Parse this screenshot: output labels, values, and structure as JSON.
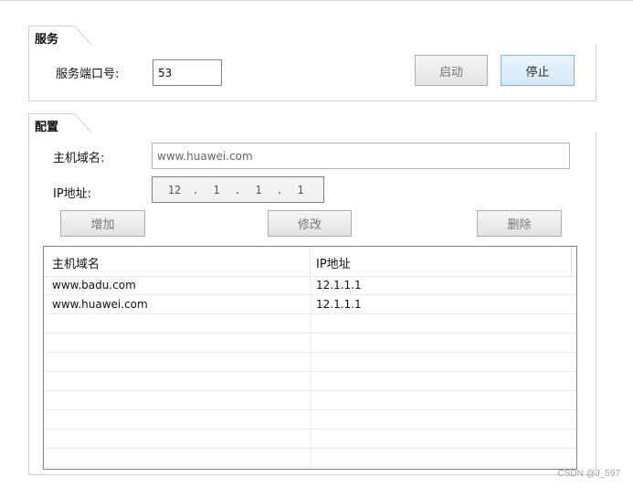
{
  "service": {
    "group_title": "服务",
    "port_label": "服务端口号:",
    "port_value": "53",
    "start_label": "启动",
    "stop_label": "停止"
  },
  "config": {
    "group_title": "配置",
    "host_label": "主机域名:",
    "host_value": "www.huawei.com",
    "ip_label": "IP地址:",
    "ip_octets": [
      "12",
      "1",
      "1",
      "1"
    ],
    "ip_dot": ".",
    "add_label": "增加",
    "edit_label": "修改",
    "delete_label": "删除"
  },
  "table": {
    "columns": [
      "主机域名",
      "IP地址"
    ],
    "rows": [
      [
        "www.badu.com",
        "12.1.1.1"
      ],
      [
        "www.huawei.com",
        "12.1.1.1"
      ]
    ]
  },
  "watermark": "CSDN @J_597",
  "colors": {
    "primary_button_border": "#7eb4ea",
    "primary_button_bg": "#d5e8f9",
    "border": "#d0d0d0"
  }
}
